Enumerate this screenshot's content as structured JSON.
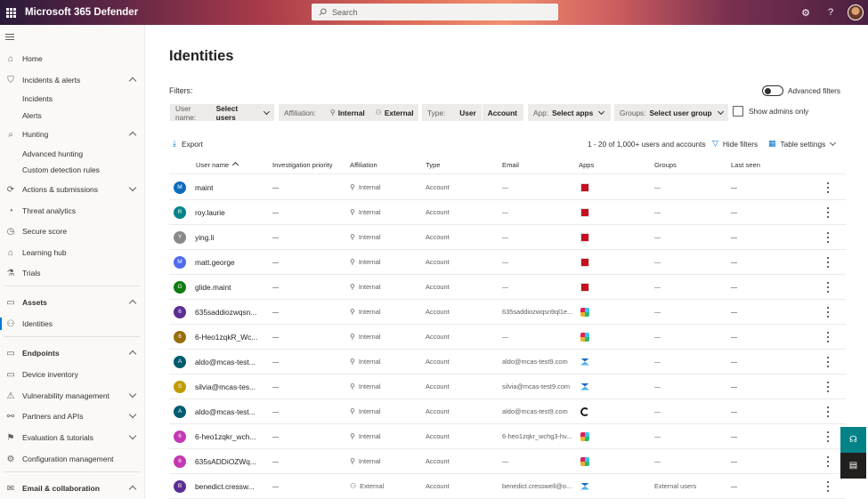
{
  "app": {
    "title": "Microsoft 365 Defender"
  },
  "search": {
    "placeholder": "Search"
  },
  "topbar_icons": [
    "gear-icon",
    "help-icon",
    "avatar"
  ],
  "nav": {
    "items": [
      {
        "label": "Home",
        "icon": "home-icon"
      },
      {
        "label": "Incidents & alerts",
        "icon": "shield-icon",
        "chevron": "up"
      },
      {
        "label": "Incidents",
        "sub": true
      },
      {
        "label": "Alerts",
        "sub": true
      },
      {
        "label": "Hunting",
        "icon": "hunting-icon",
        "chevron": "up"
      },
      {
        "label": "Advanced hunting",
        "sub": true
      },
      {
        "label": "Custom detection rules",
        "sub": true
      },
      {
        "label": "Actions & submissions",
        "icon": "actions-icon",
        "chevron": "down"
      },
      {
        "label": "Threat analytics",
        "icon": "threat-icon"
      },
      {
        "label": "Secure score",
        "icon": "score-icon"
      },
      {
        "label": "Learning hub",
        "icon": "learning-icon"
      },
      {
        "label": "Trials",
        "icon": "trials-icon"
      },
      {
        "label": "Assets",
        "section": true,
        "chevron": "up"
      },
      {
        "label": "Identities",
        "icon": "person-icon",
        "active": true
      },
      {
        "label": "Endpoints",
        "section": true,
        "chevron": "up"
      },
      {
        "label": "Device inventory",
        "icon": "device-icon"
      },
      {
        "label": "Vulnerability management",
        "icon": "vuln-icon",
        "chevron": "down"
      },
      {
        "label": "Partners and APIs",
        "icon": "partners-icon",
        "chevron": "down"
      },
      {
        "label": "Evaluation & tutorials",
        "icon": "eval-icon",
        "chevron": "down"
      },
      {
        "label": "Configuration management",
        "icon": "config-icon"
      },
      {
        "label": "Email & collaboration",
        "icon": "email-icon",
        "chevron": "up"
      }
    ]
  },
  "page": {
    "title": "Identities",
    "filters_label": "Filters:",
    "advanced_filters": "Advanced filters",
    "show_admins": "Show admins only"
  },
  "filters": {
    "username": {
      "key": "User name:",
      "value": "Select users"
    },
    "affiliation": {
      "key": "Affiliation:",
      "opt1": "Internal",
      "opt2": "External"
    },
    "type": {
      "key": "Type:",
      "opt1": "User",
      "opt2": "Account"
    },
    "app": {
      "key": "App:",
      "value": "Select apps"
    },
    "groups": {
      "key": "Groups:",
      "value": "Select user group"
    }
  },
  "toolbar": {
    "export": "Export",
    "count": "1 - 20 of 1,000+ users and accounts",
    "hide_filters": "Hide filters",
    "table_settings": "Table settings"
  },
  "table": {
    "columns": [
      "User name",
      "Investigation priority",
      "Affiliation",
      "Type",
      "Email",
      "Apps",
      "Groups",
      "Last seen"
    ],
    "rows": [
      {
        "initial": "M",
        "color": "#0f6cbd",
        "name": "maint",
        "priority": "—",
        "affiliation": "Internal",
        "type": "Account",
        "email": "—",
        "app": "red",
        "groups": "—",
        "last_seen": "—"
      },
      {
        "initial": "R",
        "color": "#038387",
        "name": "roy.laurie",
        "priority": "—",
        "affiliation": "Internal",
        "type": "Account",
        "email": "—",
        "app": "red",
        "groups": "—",
        "last_seen": "—"
      },
      {
        "initial": "Y",
        "color": "#8a8886",
        "name": "ying.li",
        "priority": "—",
        "affiliation": "Internal",
        "type": "Account",
        "email": "—",
        "app": "red",
        "groups": "—",
        "last_seen": "—"
      },
      {
        "initial": "M",
        "color": "#4f6bed",
        "name": "matt.george",
        "priority": "—",
        "affiliation": "Internal",
        "type": "Account",
        "email": "—",
        "app": "red",
        "groups": "—",
        "last_seen": "—"
      },
      {
        "initial": "G",
        "color": "#107c10",
        "name": "glide.maint",
        "priority": "—",
        "affiliation": "Internal",
        "type": "Account",
        "email": "—",
        "app": "red",
        "groups": "—",
        "last_seen": "—"
      },
      {
        "initial": "6",
        "color": "#5c2e91",
        "name": "635saddiozwqsn...",
        "priority": "—",
        "affiliation": "Internal",
        "type": "Account",
        "email": "635saddiozwqsn9ql1e...",
        "app": "slack",
        "groups": "—",
        "last_seen": "—"
      },
      {
        "initial": "6",
        "color": "#986f0b",
        "name": "6-Heo1zqkR_Wc...",
        "priority": "—",
        "affiliation": "Internal",
        "type": "Account",
        "email": "—",
        "app": "slack",
        "groups": "—",
        "last_seen": "—"
      },
      {
        "initial": "A",
        "color": "#005b70",
        "name": "aldo@mcas-test...",
        "priority": "—",
        "affiliation": "Internal",
        "type": "Account",
        "email": "aldo@mcas-test9.com",
        "app": "hr",
        "groups": "—",
        "last_seen": "—"
      },
      {
        "initial": "S",
        "color": "#c19c00",
        "name": "silvia@mcas-tes...",
        "priority": "—",
        "affiliation": "Internal",
        "type": "Account",
        "email": "silvia@mcas-test9.com",
        "app": "hr",
        "groups": "—",
        "last_seen": "—"
      },
      {
        "initial": "A",
        "color": "#005b70",
        "name": "aldo@mcas-test...",
        "priority": "—",
        "affiliation": "Internal",
        "type": "Account",
        "email": "aldo@mcas-test9.com",
        "app": "dark",
        "groups": "—",
        "last_seen": "—"
      },
      {
        "initial": "6",
        "color": "#c239b3",
        "name": "6-heo1zqkr_wch...",
        "priority": "—",
        "affiliation": "Internal",
        "type": "Account",
        "email": "6-heo1zqkr_wchg3-hv...",
        "app": "slack",
        "groups": "—",
        "last_seen": "—"
      },
      {
        "initial": "6",
        "color": "#c239b3",
        "name": "635sADDiOZWq...",
        "priority": "—",
        "affiliation": "Internal",
        "type": "Account",
        "email": "—",
        "app": "slack",
        "groups": "—",
        "last_seen": "—"
      },
      {
        "initial": "B",
        "color": "#5c2e91",
        "name": "benedict.cressw...",
        "priority": "—",
        "affiliation": "External",
        "type": "Account",
        "email": "benedict.cresswell@o...",
        "app": "hr",
        "groups": "External users",
        "last_seen": "—"
      }
    ]
  },
  "fab": [
    "feedback-icon",
    "chat-icon"
  ]
}
